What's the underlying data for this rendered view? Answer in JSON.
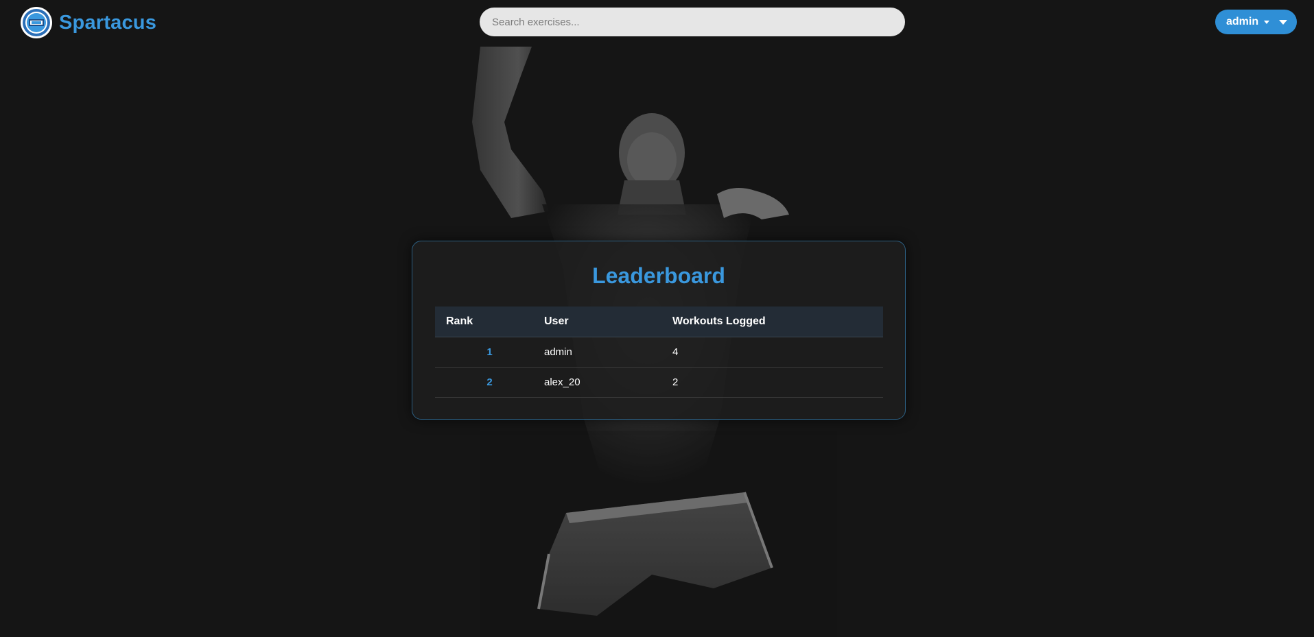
{
  "header": {
    "brand_name": "Spartacus",
    "logo_icon": "crunch-logo-icon",
    "search_placeholder": "Search exercises...",
    "user_menu_label": "admin"
  },
  "leaderboard": {
    "title": "Leaderboard",
    "columns": [
      "Rank",
      "User",
      "Workouts Logged"
    ],
    "rows": [
      {
        "rank": "1",
        "user": "admin",
        "workouts": "4"
      },
      {
        "rank": "2",
        "user": "alex_20",
        "workouts": "2"
      }
    ]
  },
  "colors": {
    "accent": "#3a98de",
    "button": "#2f8fd6",
    "background": "#151515",
    "card_border": "#2c5f82"
  }
}
